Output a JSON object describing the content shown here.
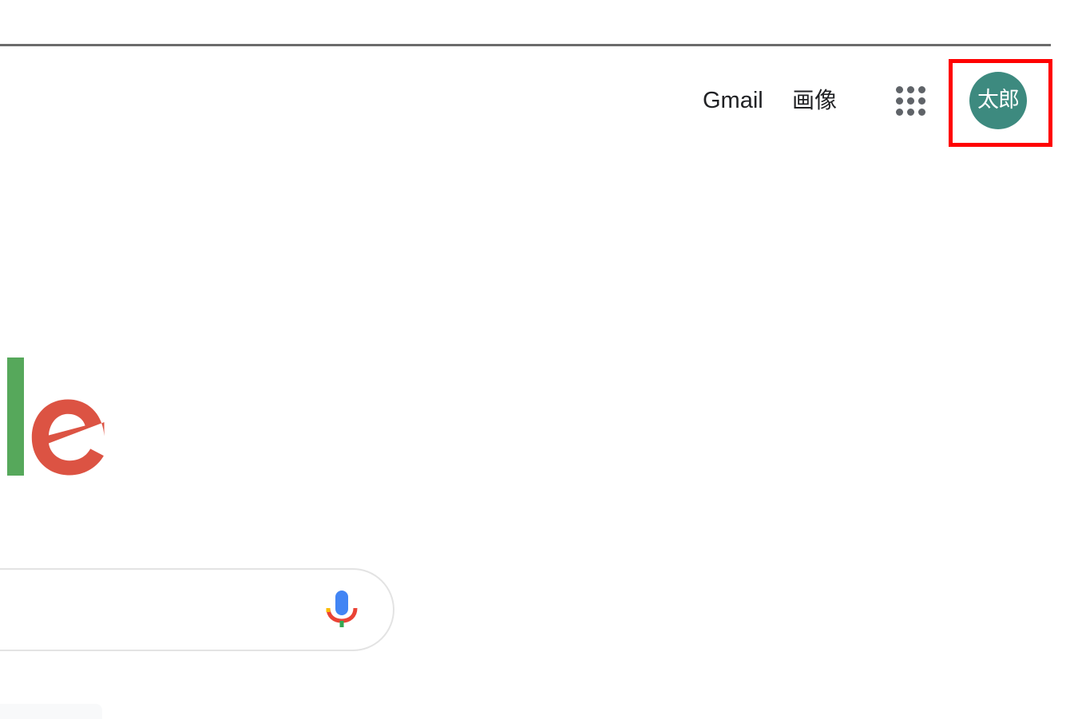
{
  "header": {
    "links": [
      {
        "label": "Gmail"
      },
      {
        "label": "画像"
      }
    ],
    "apps_icon": "apps-grid-icon",
    "account": {
      "initials": "太郎",
      "color": "#3d8a7f"
    }
  },
  "highlight": {
    "color": "#ff0000",
    "target": "account-avatar"
  },
  "logo": {
    "visible_letters": [
      "l",
      "e"
    ],
    "colors": {
      "l": "#56a85b",
      "e": "#dc5343"
    }
  },
  "search": {
    "value": "",
    "mic_icon": "microphone-icon"
  },
  "colors": {
    "text": "#202124",
    "icon_gray": "#5f6368",
    "border": "#e3e3e3",
    "divider": "#6b6b6b"
  }
}
